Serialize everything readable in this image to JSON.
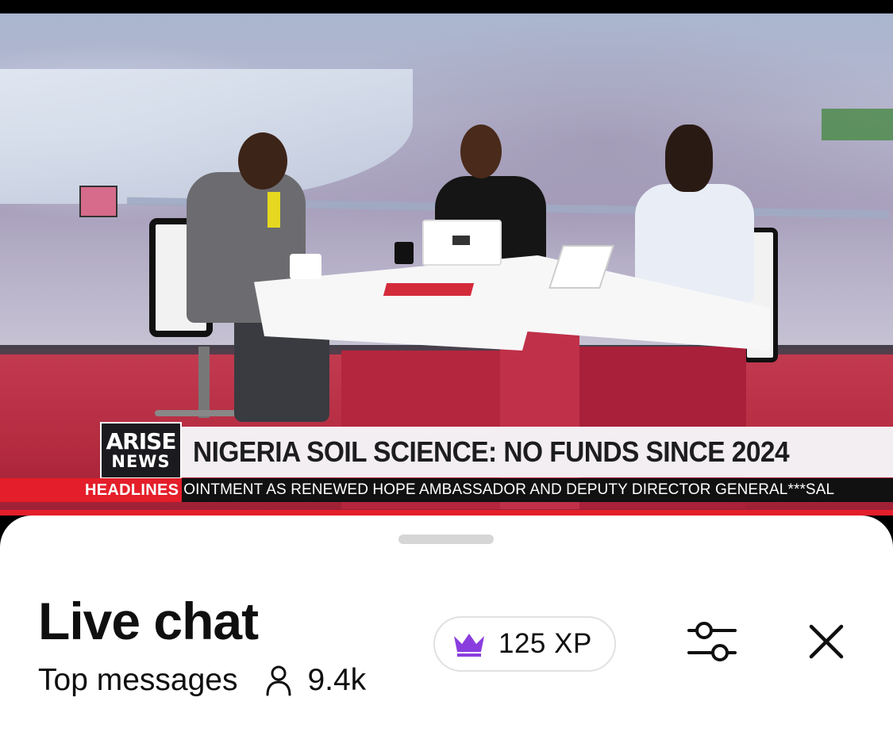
{
  "video": {
    "channel_logo": {
      "line1": "ARISE",
      "line2": "NEWS"
    },
    "headline": "NIGERIA SOIL SCIENCE: NO FUNDS SINCE 2024",
    "ticker_label": "HEADLINES",
    "ticker_text": "OINTMENT AS RENEWED HOPE AMBASSADOR AND DEPUTY DIRECTOR GENERAL***SAL"
  },
  "chat": {
    "title": "Live chat",
    "mode": "Top messages",
    "viewer_icon": "person-icon",
    "viewer_count": "9.4k",
    "xp": {
      "icon": "crown-icon",
      "label": "125 XP",
      "color": "#8a3dde"
    },
    "filter_icon": "sliders-icon",
    "close_icon": "close-icon"
  },
  "colors": {
    "accent_red": "#e41e2a",
    "crown_purple": "#8a3dde"
  }
}
